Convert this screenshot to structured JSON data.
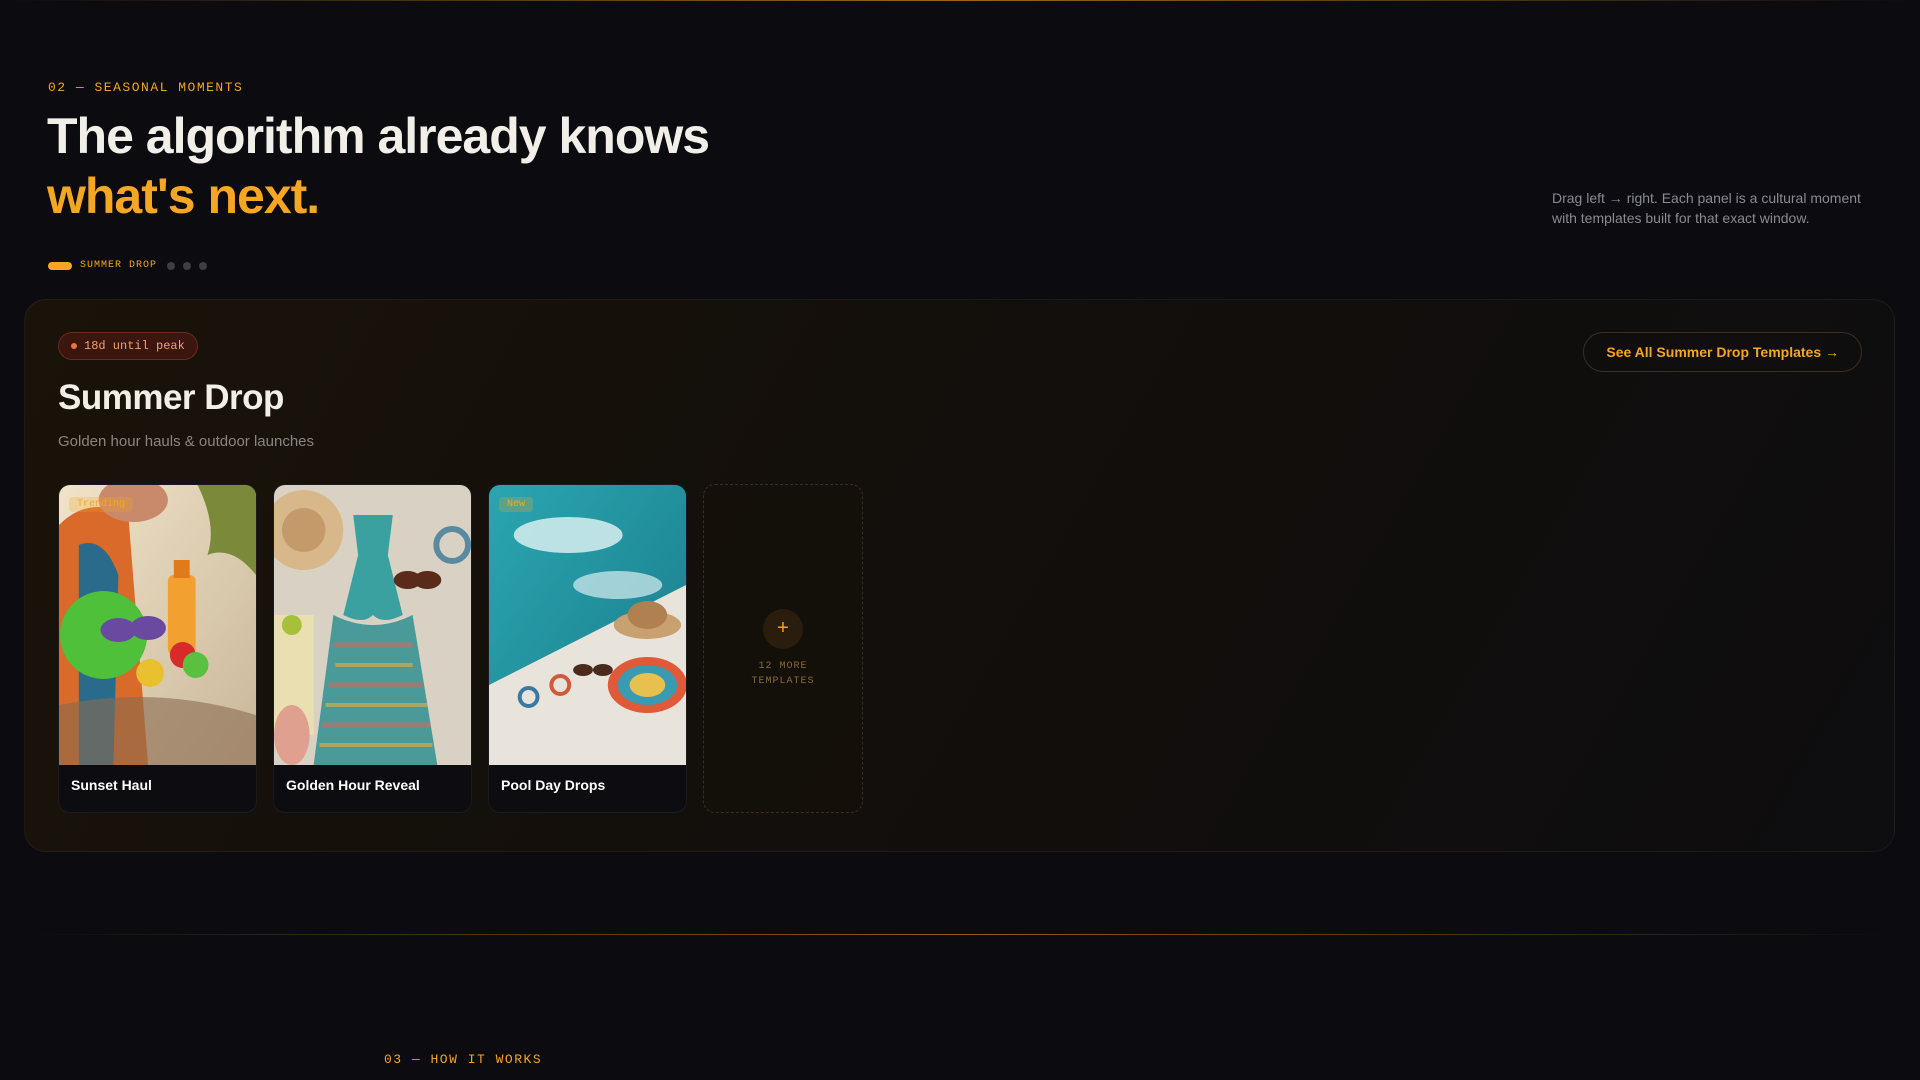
{
  "section": {
    "eyebrow": "02 — SEASONAL MOMENTS",
    "headline_line1": "The algorithm already knows",
    "headline_line2": "what's next.",
    "hint": "Drag left → right. Each panel is a cultural moment with templates built for that exact window."
  },
  "slider": {
    "active_label": "SUMMER DROP",
    "inactive_count": 3
  },
  "panel": {
    "countdown": "18d until peak",
    "title": "Summer Drop",
    "subtitle": "Golden hour hauls & outdoor launches",
    "see_all_label": "See All Summer Drop Templates →",
    "cards": [
      {
        "title": "Sunset Haul",
        "badge": "Trending"
      },
      {
        "title": "Golden Hour Reveal",
        "badge": ""
      },
      {
        "title": "Pool Day Drops",
        "badge": "New"
      }
    ],
    "more": {
      "icon": "plus-icon",
      "label": "12 MORE TEMPLATES"
    }
  },
  "next_section": {
    "eyebrow": "03 — HOW IT WORKS"
  },
  "colors": {
    "accent": "#f5a623",
    "background": "#0b0b10",
    "text": "#f2efe9"
  }
}
